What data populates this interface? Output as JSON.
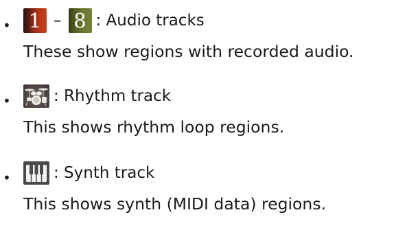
{
  "items": [
    {
      "bullet": "•",
      "icons": [
        {
          "name": "track-1-icon",
          "text": "1"
        },
        {
          "name": "track-8-icon",
          "text": "8"
        }
      ],
      "separator": "–",
      "label": ": Audio tracks",
      "description": "These show regions with recorded audio."
    },
    {
      "bullet": "•",
      "icon_name": "drum-kit-icon",
      "label": ": Rhythm track",
      "description": "This shows rhythm loop regions."
    },
    {
      "bullet": "•",
      "icon_name": "piano-keys-icon",
      "label": ": Synth track",
      "description": "This shows synth (MIDI data) regions."
    }
  ]
}
